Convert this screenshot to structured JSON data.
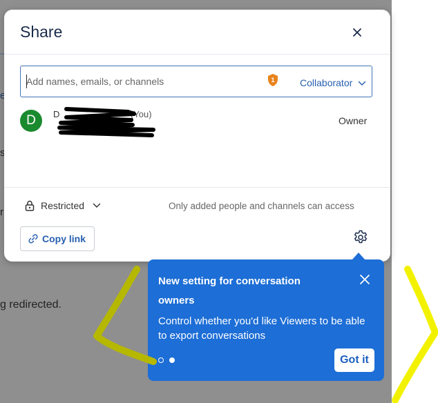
{
  "background": {
    "text_fragment": "g redirected.",
    "edge_chars": [
      "e",
      "s",
      "r"
    ]
  },
  "dialog": {
    "title": "Share",
    "input": {
      "placeholder": "Add names, emails, or channels",
      "value": ""
    },
    "role_select": {
      "selected": "Collaborator"
    },
    "members": [
      {
        "avatar_initial": "D",
        "name_initial": "D",
        "you_tag": "(You)",
        "role": "Owner"
      }
    ],
    "general_access": {
      "label": "Restricted",
      "description": "Only added people and channels can access"
    },
    "copy_link_label": "Copy link"
  },
  "tooltip": {
    "title": "New setting for conversation owners",
    "body": "Control whether you'd like Viewers to be able to export conversations",
    "got_it": "Got it",
    "steps_total": 2,
    "current_step": 2
  },
  "colors": {
    "accent": "#2860b0",
    "tooltip_bg": "#1d6ed6",
    "avatar_bg": "#1a8a2e",
    "shield": "#e8831c",
    "annotation_olive": "#b6b800",
    "annotation_yellow": "#f2f200"
  },
  "icons": [
    "close-icon",
    "shield-icon",
    "chevron-down-icon",
    "lock-icon",
    "link-icon",
    "gear-icon"
  ]
}
